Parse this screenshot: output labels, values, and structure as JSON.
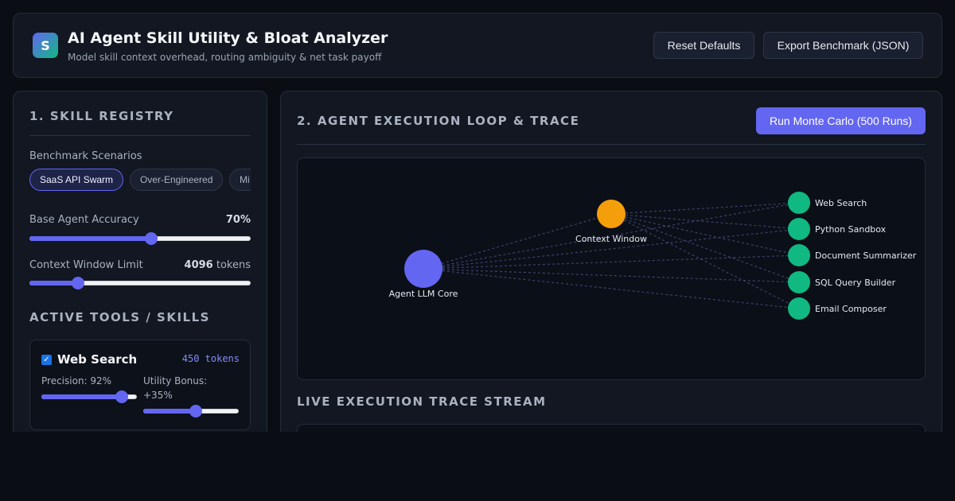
{
  "header": {
    "logo_letter": "S",
    "title": "AI Agent Skill Utility & Bloat Analyzer",
    "subtitle": "Model skill context overhead, routing ambiguity & net task payoff",
    "reset_label": "Reset Defaults",
    "export_label": "Export Benchmark (JSON)"
  },
  "registry": {
    "title": "1. SKILL REGISTRY",
    "scenarios_label": "Benchmark Scenarios",
    "scenarios": [
      {
        "label": "SaaS API Swarm",
        "active": true
      },
      {
        "label": "Over-Engineered",
        "active": false
      },
      {
        "label": "Mi",
        "active": false
      }
    ],
    "accuracy": {
      "label": "Base Agent Accuracy",
      "value_text": "70%",
      "fraction": 0.55
    },
    "context": {
      "label": "Context Window Limit",
      "value_text": "4096",
      "unit": "tokens",
      "fraction": 0.22
    },
    "tools_title": "ACTIVE TOOLS / SKILLS",
    "tools": [
      {
        "name": "Web Search",
        "enabled": true,
        "tokens_text": "450 tokens",
        "precision_label": "Precision: 92%",
        "precision_fraction": 0.84,
        "utility_label": "Utility Bonus: +35%",
        "utility_fraction": 0.55
      }
    ]
  },
  "execution": {
    "title": "2. AGENT EXECUTION LOOP & TRACE",
    "run_label": "Run Monte Carlo (500 Runs)",
    "nodes": {
      "core": "Agent LLM Core",
      "context": "Context Window",
      "skills": [
        "Web Search",
        "Python Sandbox",
        "Document Summarizer",
        "SQL Query Builder",
        "Email Composer"
      ]
    },
    "colors": {
      "core": "#6366f1",
      "context": "#f59e0b",
      "skill": "#10b981",
      "edge": "#3b4170"
    },
    "trace_title": "LIVE EXECUTION TRACE STREAM"
  }
}
